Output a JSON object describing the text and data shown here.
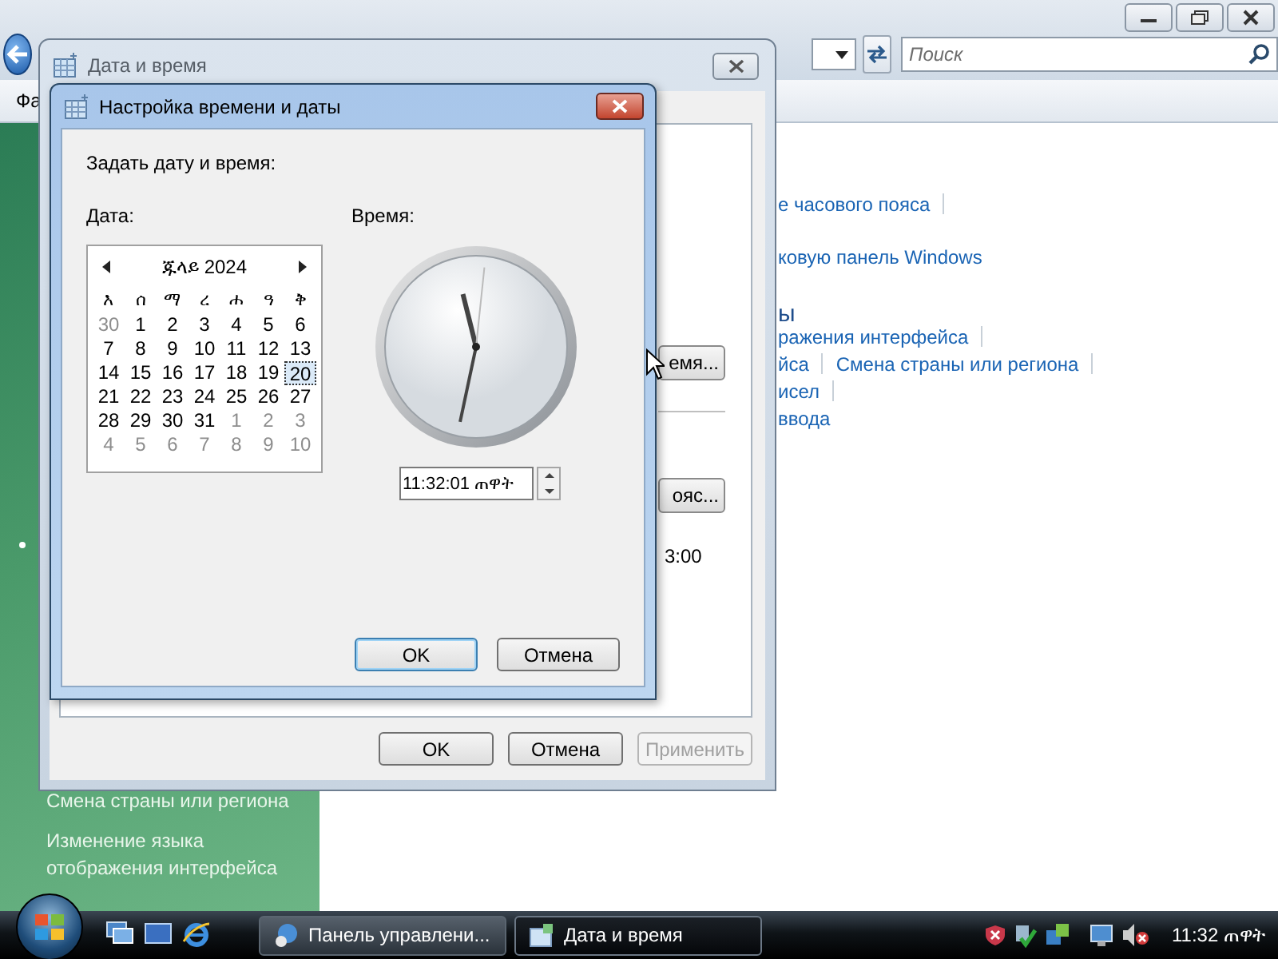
{
  "control_panel": {
    "menu_text": "Фа",
    "search": {
      "placeholder": "Поиск"
    },
    "content_rows": [
      {
        "kind": "links",
        "links": [
          {
            "text": "е часового пояса",
            "separator": true
          }
        ]
      },
      {
        "kind": "links",
        "links": [
          {
            "text": "ковую панель Windows",
            "separator": false
          }
        ]
      },
      {
        "kind": "heading",
        "links": [
          {
            "text": "ы",
            "separator": false
          }
        ]
      },
      {
        "kind": "links",
        "links": [
          {
            "text": "ражения интерфейса",
            "separator": true
          }
        ]
      },
      {
        "kind": "links",
        "links": [
          {
            "text": "йса",
            "separator": true
          },
          {
            "text": "Смена страны или региона",
            "separator": true
          }
        ]
      },
      {
        "kind": "links",
        "links": [
          {
            "text": "исел",
            "separator": true
          }
        ]
      },
      {
        "kind": "links",
        "links": [
          {
            "text": "ввода",
            "separator": false
          }
        ]
      }
    ],
    "sidebar_links": [
      "Смена страны или региона",
      "Изменение языка отображения интерфейса"
    ]
  },
  "date_time_window": {
    "title": "Дата и время",
    "partial_buttons": [
      "емя...",
      "ояс..."
    ],
    "time_text": "3:00",
    "buttons": [
      {
        "label": "OK",
        "disabled": false
      },
      {
        "label": "Отмена",
        "disabled": false
      },
      {
        "label": "Применить",
        "disabled": true
      }
    ]
  },
  "dialog": {
    "title": "Настройка времени и даты",
    "heading": "Задать дату и время:",
    "date_label": "Дата:",
    "time_label": "Время:",
    "calendar": {
      "month": "ጁላይ 2024",
      "weekdays": [
        "እ",
        "ሰ",
        "ማ",
        "ረ",
        "ሐ",
        "ዓ",
        "ቅ"
      ],
      "days": [
        {
          "day": "30",
          "in_month": false,
          "selected": false
        },
        {
          "day": "1",
          "in_month": true,
          "selected": false
        },
        {
          "day": "2",
          "in_month": true,
          "selected": false
        },
        {
          "day": "3",
          "in_month": true,
          "selected": false
        },
        {
          "day": "4",
          "in_month": true,
          "selected": false
        },
        {
          "day": "5",
          "in_month": true,
          "selected": false
        },
        {
          "day": "6",
          "in_month": true,
          "selected": false
        },
        {
          "day": "7",
          "in_month": true,
          "selected": false
        },
        {
          "day": "8",
          "in_month": true,
          "selected": false
        },
        {
          "day": "9",
          "in_month": true,
          "selected": false
        },
        {
          "day": "10",
          "in_month": true,
          "selected": false
        },
        {
          "day": "11",
          "in_month": true,
          "selected": false
        },
        {
          "day": "12",
          "in_month": true,
          "selected": false
        },
        {
          "day": "13",
          "in_month": true,
          "selected": false
        },
        {
          "day": "14",
          "in_month": true,
          "selected": false
        },
        {
          "day": "15",
          "in_month": true,
          "selected": false
        },
        {
          "day": "16",
          "in_month": true,
          "selected": false
        },
        {
          "day": "17",
          "in_month": true,
          "selected": false
        },
        {
          "day": "18",
          "in_month": true,
          "selected": false
        },
        {
          "day": "19",
          "in_month": true,
          "selected": false
        },
        {
          "day": "20",
          "in_month": true,
          "selected": true
        },
        {
          "day": "21",
          "in_month": true,
          "selected": false
        },
        {
          "day": "22",
          "in_month": true,
          "selected": false
        },
        {
          "day": "23",
          "in_month": true,
          "selected": false
        },
        {
          "day": "24",
          "in_month": true,
          "selected": false
        },
        {
          "day": "25",
          "in_month": true,
          "selected": false
        },
        {
          "day": "26",
          "in_month": true,
          "selected": false
        },
        {
          "day": "27",
          "in_month": true,
          "selected": false
        },
        {
          "day": "28",
          "in_month": true,
          "selected": false
        },
        {
          "day": "29",
          "in_month": true,
          "selected": false
        },
        {
          "day": "30",
          "in_month": true,
          "selected": false
        },
        {
          "day": "31",
          "in_month": true,
          "selected": false
        },
        {
          "day": "1",
          "in_month": false,
          "selected": false
        },
        {
          "day": "2",
          "in_month": false,
          "selected": false
        },
        {
          "day": "3",
          "in_month": false,
          "selected": false
        },
        {
          "day": "4",
          "in_month": false,
          "selected": false
        },
        {
          "day": "5",
          "in_month": false,
          "selected": false
        },
        {
          "day": "6",
          "in_month": false,
          "selected": false
        },
        {
          "day": "7",
          "in_month": false,
          "selected": false
        },
        {
          "day": "8",
          "in_month": false,
          "selected": false
        },
        {
          "day": "9",
          "in_month": false,
          "selected": false
        },
        {
          "day": "10",
          "in_month": false,
          "selected": false
        }
      ]
    },
    "time_value": "11:32:01 ጠዋት",
    "buttons": [
      {
        "label": "OK",
        "default": true
      },
      {
        "label": "Отмена",
        "default": false
      }
    ]
  },
  "taskbar": {
    "tasks": [
      {
        "label": "Панель управлени...",
        "selected": false
      },
      {
        "label": "Дата и время",
        "selected": true
      }
    ],
    "clock": "11:32 ጠዋት"
  }
}
